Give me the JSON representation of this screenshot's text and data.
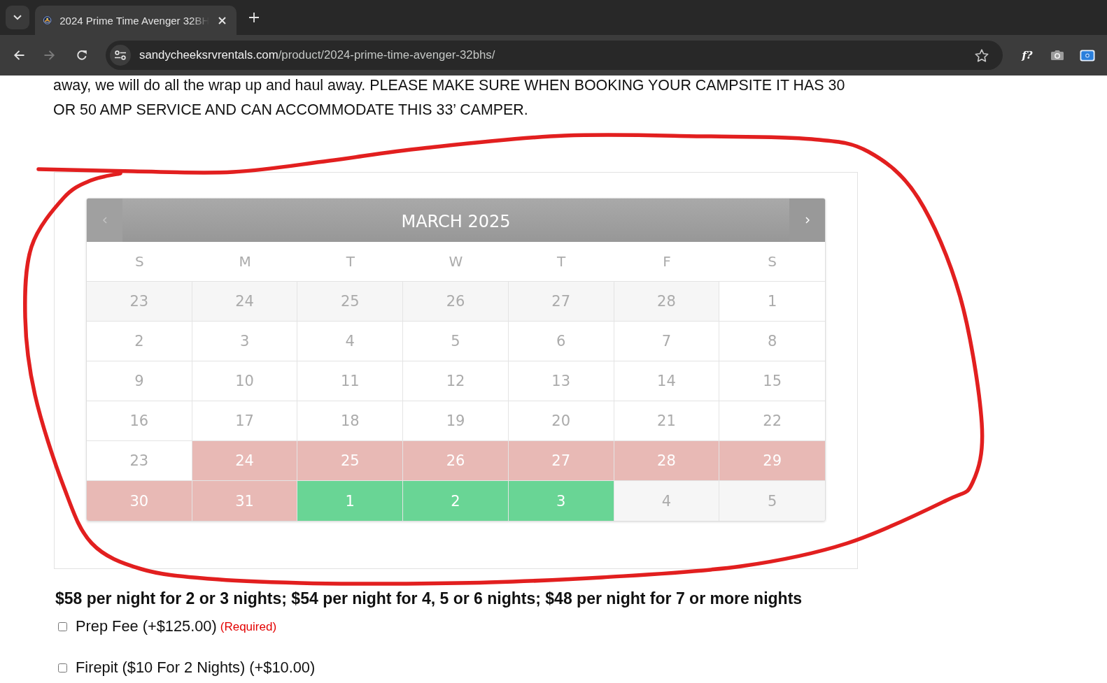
{
  "browser": {
    "tabs": [
      {
        "title": "2024 Prime Time Avenger 32BH",
        "selected": true
      }
    ],
    "toolbar": {
      "back_enabled": true,
      "forward_enabled": false
    },
    "address": {
      "host": "sandycheeksrvrentals.com",
      "path": "/product/2024-prime-time-avenger-32bhs/"
    },
    "bookmarked": false,
    "extensions": [
      {
        "kind": "text",
        "label": "f?"
      },
      {
        "kind": "camera"
      },
      {
        "kind": "screen"
      }
    ]
  },
  "page": {
    "description": "away, we will do all the wrap up and haul away. PLEASE MAKE SURE WHEN BOOKING YOUR CAMPSITE IT HAS 30 OR 50 AMP SERVICE AND CAN ACCOMMODATE THIS 33’ CAMPER.",
    "calendar": {
      "month": "MARCH 2025",
      "prev_enabled": false,
      "next_enabled": true,
      "weekdays": [
        "S",
        "M",
        "T",
        "W",
        "T",
        "F",
        "S"
      ],
      "days": [
        {
          "day": "23",
          "kind": "other_month"
        },
        {
          "day": "24",
          "kind": "other_month"
        },
        {
          "day": "25",
          "kind": "other_month"
        },
        {
          "day": "26",
          "kind": "other_month"
        },
        {
          "day": "27",
          "kind": "other_month"
        },
        {
          "day": "28",
          "kind": "other_month"
        },
        {
          "day": "1",
          "kind": "open"
        },
        {
          "day": "2",
          "kind": "open"
        },
        {
          "day": "3",
          "kind": "open"
        },
        {
          "day": "4",
          "kind": "open"
        },
        {
          "day": "5",
          "kind": "open"
        },
        {
          "day": "6",
          "kind": "open"
        },
        {
          "day": "7",
          "kind": "open"
        },
        {
          "day": "8",
          "kind": "open"
        },
        {
          "day": "9",
          "kind": "open"
        },
        {
          "day": "10",
          "kind": "open"
        },
        {
          "day": "11",
          "kind": "open"
        },
        {
          "day": "12",
          "kind": "open"
        },
        {
          "day": "13",
          "kind": "open"
        },
        {
          "day": "14",
          "kind": "open"
        },
        {
          "day": "15",
          "kind": "open"
        },
        {
          "day": "16",
          "kind": "open"
        },
        {
          "day": "17",
          "kind": "open"
        },
        {
          "day": "18",
          "kind": "open"
        },
        {
          "day": "19",
          "kind": "open"
        },
        {
          "day": "20",
          "kind": "open"
        },
        {
          "day": "21",
          "kind": "open"
        },
        {
          "day": "22",
          "kind": "open"
        },
        {
          "day": "23",
          "kind": "open"
        },
        {
          "day": "24",
          "kind": "booked"
        },
        {
          "day": "25",
          "kind": "booked"
        },
        {
          "day": "26",
          "kind": "booked"
        },
        {
          "day": "27",
          "kind": "booked"
        },
        {
          "day": "28",
          "kind": "booked"
        },
        {
          "day": "29",
          "kind": "booked"
        },
        {
          "day": "30",
          "kind": "booked"
        },
        {
          "day": "31",
          "kind": "booked"
        },
        {
          "day": "1",
          "kind": "available"
        },
        {
          "day": "2",
          "kind": "available"
        },
        {
          "day": "3",
          "kind": "available"
        },
        {
          "day": "4",
          "kind": "other_month"
        },
        {
          "day": "5",
          "kind": "other_month"
        }
      ]
    },
    "price_note": "$58 per night for 2 or 3 nights; $54 per night for 4, 5 or 6 nights; $48 per night for 7 or more nights",
    "options": [
      {
        "label": "Prep Fee (+$125.00)",
        "required_note": "(Required)",
        "checked": false
      },
      {
        "label": "Firepit ($10 For 2 Nights) (+$10.00)",
        "checked": false
      }
    ]
  },
  "annotations": [
    {
      "kind": "freehand_loop"
    }
  ]
}
